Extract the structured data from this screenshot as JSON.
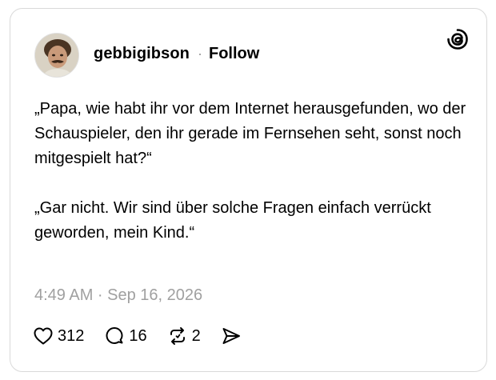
{
  "post": {
    "author": {
      "username": "gebbigibson",
      "separator": "·",
      "follow_label": "Follow",
      "avatar_icon": "profile-photo"
    },
    "brand_icon": "threads-logo-icon",
    "body": {
      "paragraph_1": "„Papa, wie habt ihr vor dem Internet herausgefunden, wo der Schauspieler, den ihr gerade im Fernsehen seht, sonst noch mitgespielt hat?“",
      "paragraph_2": "„Gar nicht. Wir sind über solche Fragen einfach verrückt geworden, mein Kind.“"
    },
    "timestamp": "4:49 AM · Sep 16, 2026",
    "stats": {
      "likes": "312",
      "replies": "16",
      "reposts": "2"
    }
  },
  "colors": {
    "text": "#000000",
    "muted": "#a0a0a0",
    "border": "#d9d9d9",
    "background": "#ffffff"
  }
}
